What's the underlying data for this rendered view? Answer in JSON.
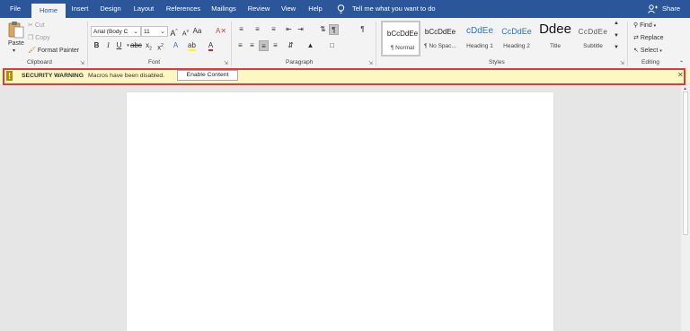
{
  "tabs": [
    "File",
    "Home",
    "Insert",
    "Design",
    "Layout",
    "References",
    "Mailings",
    "Review",
    "View",
    "Help"
  ],
  "active_tab": "Home",
  "tell_me": "Tell me what you want to do",
  "share": "Share",
  "clipboard": {
    "paste": "Paste",
    "cut": "Cut",
    "copy": "Copy",
    "format_painter": "Format Painter",
    "label": "Clipboard"
  },
  "font": {
    "name": "Arial (Body C",
    "size": "11",
    "label": "Font"
  },
  "paragraph": {
    "label": "Paragraph"
  },
  "styles": {
    "label": "Styles",
    "items": [
      {
        "preview": "bCcDdEe",
        "name": "¶ Normal"
      },
      {
        "preview": "bCcDdEe",
        "name": "¶ No Spac..."
      },
      {
        "preview": "cDdEe",
        "name": "Heading 1"
      },
      {
        "preview": "CcDdEe",
        "name": "Heading 2"
      },
      {
        "preview": "Ddee",
        "name": "Title"
      },
      {
        "preview": "CcDdEe",
        "name": "Subtitle"
      }
    ]
  },
  "editing": {
    "find": "Find",
    "replace": "Replace",
    "select": "Select",
    "label": "Editing"
  },
  "message_bar": {
    "title": "SECURITY WARNING",
    "message": "Macros have been disabled.",
    "button": "Enable Content"
  },
  "colors": {
    "brand": "#2b579a",
    "warning_bg": "#fdf7c3",
    "highlight_border": "#e03a3e"
  }
}
